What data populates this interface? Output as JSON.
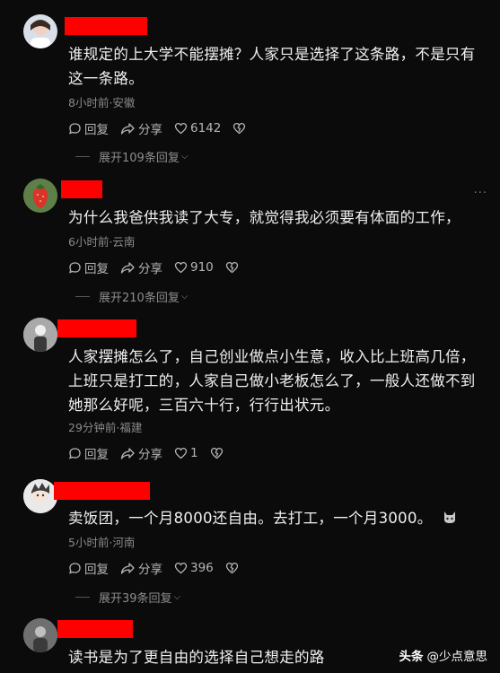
{
  "actions": {
    "reply": "回复",
    "share": "分享"
  },
  "comments": [
    {
      "text": "谁规定的上大学不能摆摊？人家只是选择了这条路，不是只有这一条路。",
      "meta": "8小时前·安徽",
      "likes": "6142",
      "expand": "展开109条回复"
    },
    {
      "text": "为什么我爸供我读了大专，就觉得我必须要有体面的工作，",
      "meta": "6小时前·云南",
      "likes": "910",
      "expand": "展开210条回复"
    },
    {
      "text": "人家摆摊怎么了，自己创业做点小生意，收入比上班高几倍，上班只是打工的，人家自己做小老板怎么了，一般人还做不到她那么好呢，三百六十行，行行出状元。",
      "meta": "29分钟前·福建",
      "likes": "1",
      "expand": ""
    },
    {
      "text": "卖饭团，一个月8000还自由。去打工，一个月3000。",
      "meta": "5小时前·河南",
      "likes": "396",
      "expand": "展开39条回复"
    },
    {
      "text": "读书是为了更自由的选择自己想走的路",
      "meta": "",
      "likes": "",
      "expand": ""
    }
  ],
  "more_icon": "more-dots-icon",
  "watermark": {
    "brand": "头条",
    "handle": "@少点意思"
  },
  "colors": {
    "background": "#0b0b0b",
    "redacted_name": "#ff0000",
    "meta": "#8a8a8a"
  }
}
